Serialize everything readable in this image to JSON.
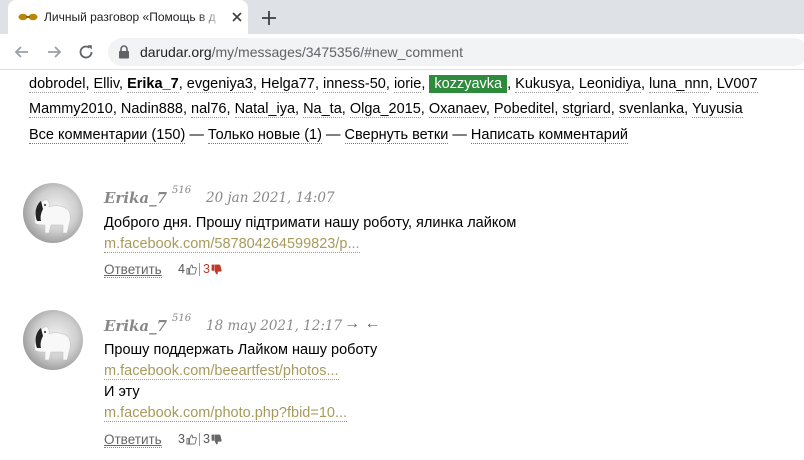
{
  "browser": {
    "tab_title": "Личный разговор «Помощь в д",
    "url_host": "darudar.org",
    "url_path": "/my/messages/3475356/#new_comment"
  },
  "users": {
    "line1": [
      {
        "name": "dobrodel"
      },
      {
        "name": "Elliv"
      },
      {
        "name": "Erika_7",
        "bold": true
      },
      {
        "name": "evgeniya3"
      },
      {
        "name": "Helga77"
      },
      {
        "name": "inness-50"
      },
      {
        "name": "iorie"
      },
      {
        "name": "kozzyavka",
        "highlight": true
      },
      {
        "name": "Kukusya"
      },
      {
        "name": "Leonidiya"
      },
      {
        "name": "luna_nnn"
      },
      {
        "name": "LV007"
      }
    ],
    "line2": [
      {
        "name": "Mammy2010"
      },
      {
        "name": "Nadin888"
      },
      {
        "name": "nal76"
      },
      {
        "name": "Natal_iya"
      },
      {
        "name": "Na_ta"
      },
      {
        "name": "Olga_2015"
      },
      {
        "name": "Oxanaev"
      },
      {
        "name": "Pobeditel"
      },
      {
        "name": "stgriard"
      },
      {
        "name": "svenlanka"
      },
      {
        "name": "Yuyusia"
      }
    ]
  },
  "controls": {
    "all_comments": "Все комментарии (150)",
    "only_new": "Только новые (1)",
    "collapse": "Свернуть ветки",
    "write": "Написать комментарий",
    "dash": "—"
  },
  "comments": [
    {
      "author": "Erika_7",
      "rating": "516",
      "date": "20 jan 2021, 14:07",
      "text": "Доброго дня. Прошу підтримати нашу роботу, ялинка лайком",
      "link": "m.facebook.com/587804264599823/p...",
      "reply": "Ответить",
      "votes_up": "4",
      "votes_down": "3"
    },
    {
      "author": "Erika_7",
      "rating": "516",
      "date": "18 may 2021, 12:17",
      "arrows": "→ ←",
      "text": "Прошу поддержать Лайком нашу роботу",
      "link": "m.facebook.com/beeartfest/photos...",
      "text2": "И эту",
      "link2": "m.facebook.com/photo.php?fbid=10...",
      "reply": "Ответить",
      "votes_up": "3",
      "votes_down": "3"
    }
  ],
  "colors": {
    "highlight": "#2e8b3c",
    "link": "#a89a5a",
    "meta": "#888888",
    "downvote": "#c0392b"
  }
}
